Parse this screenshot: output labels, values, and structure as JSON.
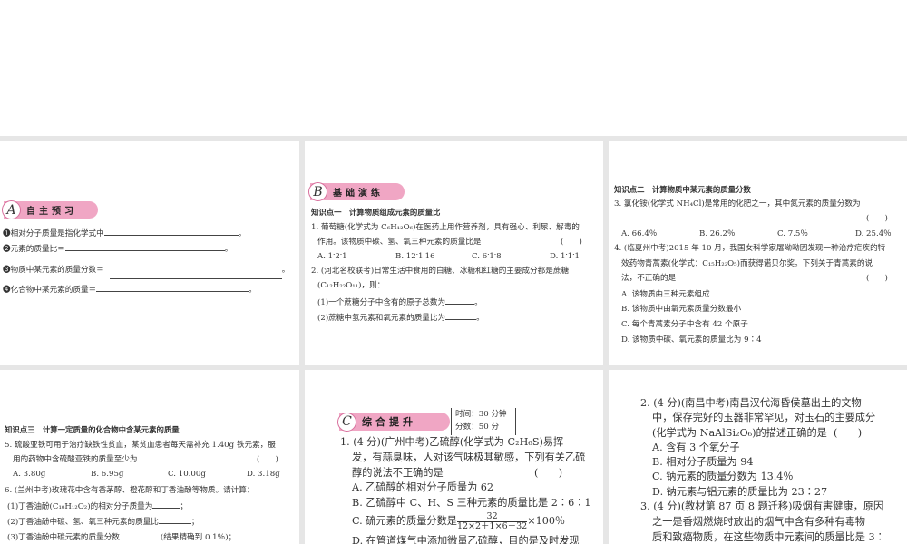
{
  "p1": {
    "badge_letter": "A",
    "badge_label": "自主预习",
    "items": [
      "❶相对分子质量是指化学式中",
      "❷元素的质量比＝",
      "❸物质中某元素的质量分数＝",
      "❹化合物中某元素的质量＝"
    ],
    "period": "。"
  },
  "p2": {
    "badge_letter": "B",
    "badge_label": "基础演练",
    "heading": "知识点一　计算物质组成元素的质量比",
    "q1_l1": "1. 葡萄糖(化学式为 C₆H₁₂O₆)在医药上用作营养剂，具有强心、利尿、解毒的",
    "q1_l2": "作用。该物质中碳、氢、氧三种元素的质量比是",
    "paren": "(　　)",
    "q1_opts": [
      "A. 1∶2∶1",
      "B. 12∶1∶16",
      "C. 6∶1∶8",
      "D. 1∶1∶1"
    ],
    "q2_l1": "2. (河北名校联考)日常生活中食用的白糖、冰糖和红糖的主要成分都是蔗糖",
    "q2_l2": "(C₁₂H₂₂O₁₁)，则：",
    "q2_s1": "(1)一个蔗糖分子中含有的原子总数为",
    "q2_s2": "(2)蔗糖中氢元素和氧元素的质量比为"
  },
  "p3": {
    "heading": "知识点二　计算物质中某元素的质量分数",
    "q3_l1": "3. 氯化铵(化学式 NH₄Cl)是常用的化肥之一，其中氮元素的质量分数为",
    "paren": "(　　)",
    "q3_opts": [
      "A. 66.4％",
      "B. 26.2％",
      "C. 7.5％",
      "D. 25.4％"
    ],
    "q4_l1": "4. (临夏州中考)2015 年 10 月，我国女科学家屠呦呦因发现一种治疗疟疾的特",
    "q4_l2": "效药物青蒿素(化学式：C₁₅H₂₂O₅)而获得诺贝尔奖。下列关于青蒿素的说",
    "q4_l3": "法，不正确的是",
    "q4_opts": [
      "A. 该物质由三种元素组成",
      "B. 该物质中由氧元素质量分数最小",
      "C. 每个青蒿素分子中含有 42 个原子",
      "D. 该物质中碳、氧元素的质量比为 9∶4"
    ]
  },
  "p4": {
    "heading": "知识点三　计算一定质量的化合物中含某元素的质量",
    "q5_l1": "5. 硫酸亚铁可用于治疗缺铁性贫血，某贫血患者每天需补充 1.40g 铁元素，服",
    "q5_l2": "用的药物中含硫酸亚铁的质量至少为",
    "paren": "(　　)",
    "q5_opts": [
      "A. 3.80g",
      "B. 6.95g",
      "C. 10.00g",
      "D. 3.18g"
    ],
    "q6_l1": "6. (兰州中考)玫瑰花中含有香茅醇、橙花醇和丁香油酚等物质。请计算：",
    "q6_s1": "(1)丁香油酚(C₁₀H₁₂O₂)的相对分子质量为",
    "q6_s2": "(2)丁香油酚中碳、氢、氧三种元素的质量比",
    "q6_s3": "(3)丁香油酚中碳元素的质量分数",
    "q6_s3_note": "(结果精确到 0.1％)；"
  },
  "p5": {
    "badge_letter": "C",
    "badge_label": "综合提升",
    "time": "时间：30 分钟",
    "score": "分数：50 分",
    "q1_l1": "1. (4 分)(广州中考)乙硫醇(化学式为 C₂H₆S)易挥",
    "q1_l2": "发，有蒜臭味，人对该气味极其敏感，下列有关乙硫",
    "q1_l3": "醇的说法不正确的是",
    "paren": "(　　)",
    "optA": "A. 乙硫醇的相对分子质量为 62",
    "optB": "B. 乙硫醇中 C、H、S 三种元素的质量比是 2∶6∶1",
    "optC": "C. 硫元素的质量分数是",
    "frac_num": "32",
    "frac_den": "12×2＋1×6＋32",
    "frac_tail": "×100％",
    "optD": "D. 在管道煤气中添加微量乙硫醇，目的是及时发现"
  },
  "p6": {
    "q2_l1": "2. (4 分)(南昌中考)南昌汉代海昏侯墓出土的文物",
    "q2_l2": "中，保存完好的玉器非常罕见，对玉石的主要成分",
    "q2_l3": "(化学式为 NaAlSi₂O₆)的描述正确的是",
    "paren": "(　　)",
    "opts": [
      "A. 含有 3 个氧分子",
      "B. 相对分子质量为 94",
      "C. 钠元素的质量分数为 13.4％",
      "D. 钠元素与铝元素的质量比为 23∶27"
    ],
    "q3_l1": "3. (4 分)(教材第 87 页 8 题迁移)吸烟有害健康，原因",
    "q3_l2": "之一是香烟燃烧时放出的烟气中含有多种有毒物",
    "q3_l3": "质和致癌物质，在这些物质中元素间的质量比是 3∶"
  }
}
